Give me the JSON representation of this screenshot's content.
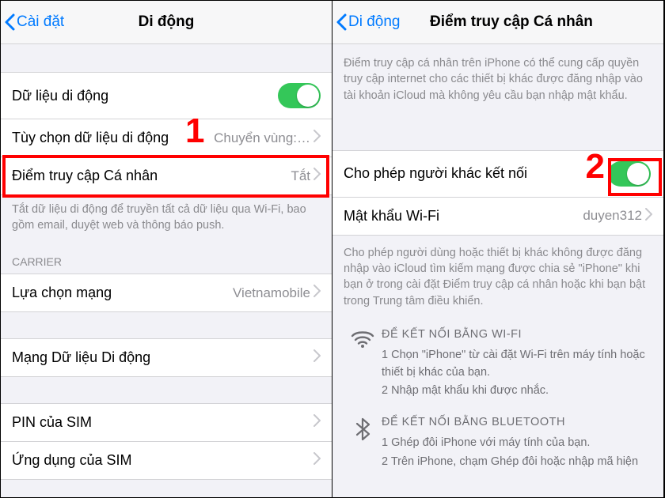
{
  "left": {
    "back": "Cài đặt",
    "title": "Di động",
    "rows": {
      "cellular_data": "Dữ liệu di động",
      "data_options": "Tùy chọn dữ liệu di động",
      "data_options_value": "Chuyển vùng:…",
      "hotspot": "Điểm truy cập Cá nhân",
      "hotspot_value": "Tắt"
    },
    "footnote": "Tắt dữ liệu di động để truyền tất cả dữ liệu qua Wi-Fi, bao gồm email, duyệt web và thông báo push.",
    "carrier_header": "CARRIER",
    "rows2": {
      "network": "Lựa chọn mạng",
      "network_value": "Vietnamobile",
      "data_network": "Mạng Dữ liệu Di động",
      "sim_pin": "PIN của SIM",
      "sim_apps": "Ứng dụng của SIM"
    },
    "badge1": "1"
  },
  "right": {
    "back": "Di động",
    "title": "Điểm truy cập Cá nhân",
    "intro": "Điểm truy cập cá nhân trên iPhone có thể cung cấp quyền truy cập internet cho các thiết bị khác được đăng nhập vào tài khoản iCloud mà không yêu cầu bạn nhập mật khẩu.",
    "rows": {
      "allow": "Cho phép người khác kết nối",
      "wifi_pwd": "Mật khẩu Wi-Fi",
      "wifi_pwd_value": "duyen312"
    },
    "note2": "Cho phép người dùng hoặc thiết bị khác không được đăng nhập vào iCloud tìm kiếm mạng được chia sẻ \"iPhone\" khi bạn ở trong cài đặt Điểm truy cập cá nhân hoặc khi bạn bật trong Trung tâm điều khiển.",
    "wifi_title": "ĐỂ KẾT NỐI BẰNG WI-FI",
    "wifi_1": "1 Chọn \"iPhone\" từ cài đặt Wi-Fi trên máy tính hoặc thiết bị khác của bạn.",
    "wifi_2": "2 Nhập mật khẩu khi được nhắc.",
    "bt_title": "ĐỂ KẾT NỐI BẰNG BLUETOOTH",
    "bt_1": "1 Ghép đôi iPhone với máy tính của bạn.",
    "bt_2": "2 Trên iPhone, chạm Ghép đôi hoặc nhập mã hiện",
    "badge2": "2"
  }
}
